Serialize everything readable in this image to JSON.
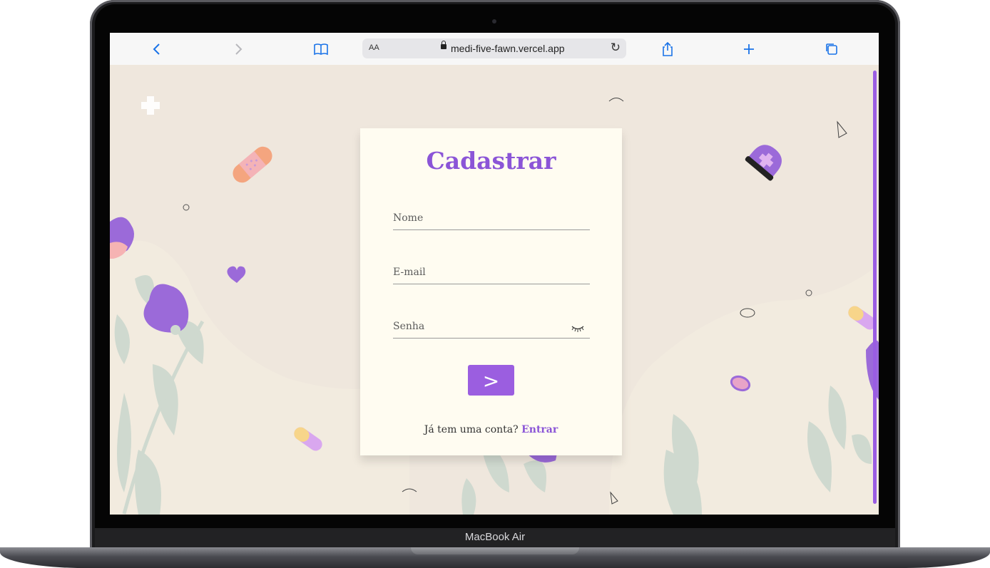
{
  "browser": {
    "url": "medi-five-fawn.vercel.app",
    "text_size_label": "AA"
  },
  "form": {
    "title": "Cadastrar",
    "name_placeholder": "Nome",
    "email_placeholder": "E-mail",
    "password_placeholder": "Senha",
    "submit_label": ">",
    "footer_prompt": "Já tem uma conta?",
    "footer_link": "Entrar"
  },
  "device": {
    "model": "MacBook Air"
  },
  "colors": {
    "accent": "#9b5ee0",
    "title": "#8b55d7",
    "card_bg": "#fffcf1",
    "page_bg": "#efe7dd",
    "leaf": "#cfd9cf"
  }
}
